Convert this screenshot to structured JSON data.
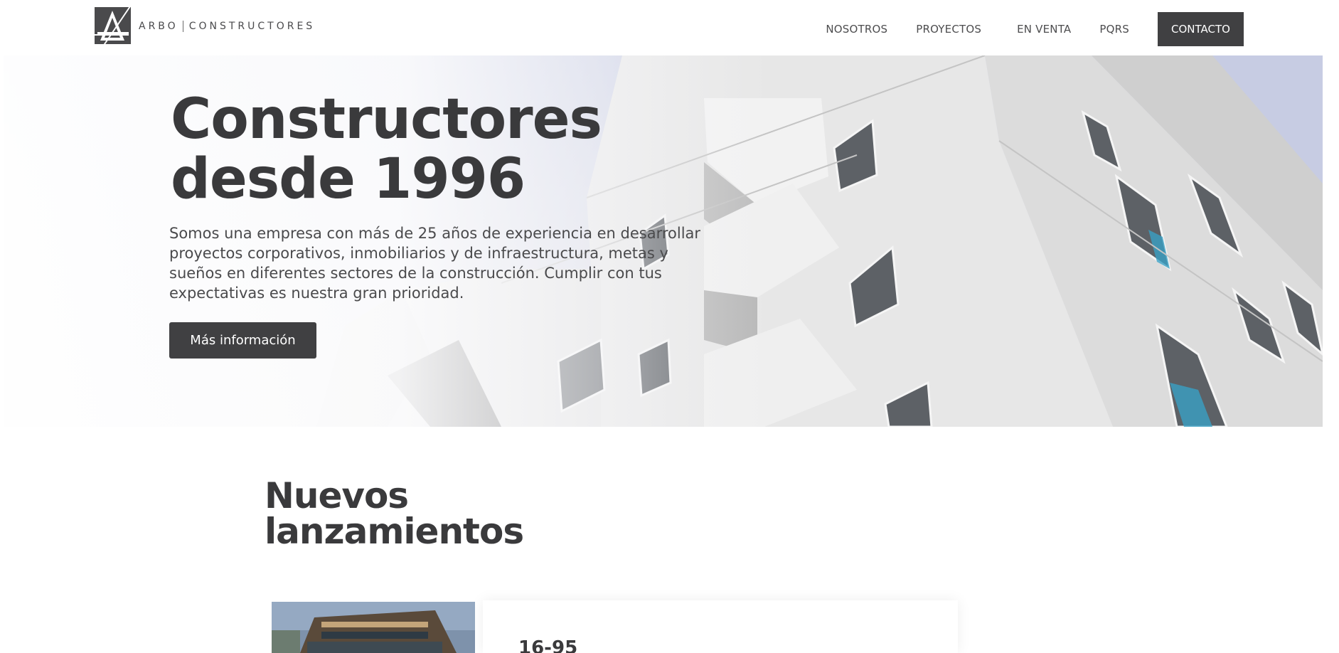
{
  "brand": {
    "name_left": "ARBO",
    "name_right": "CONSTRUCTORES",
    "logo_icon": "triangle-a-logo-icon"
  },
  "nav": {
    "items": [
      {
        "label": "NOSOTROS"
      },
      {
        "label": "PROYECTOS"
      },
      {
        "label": "EN VENTA"
      },
      {
        "label": "PQRS"
      }
    ],
    "cta_label": "CONTACTO"
  },
  "hero": {
    "title_line1": "Constructores",
    "title_line2": "desde 1996",
    "description": "Somos una empresa con más de 25 años de experiencia en desarrollar proyectos corporativos, inmobiliarios y de infraestructura, metas y sueños en diferentes sectores de la construcción. Cumplir con tus expectativas es nuestra gran prioridad.",
    "button_label": "Más información",
    "image": "white-apartment-building-photo"
  },
  "releases": {
    "title_line1": "Nuevos",
    "title_line2": "lanzamientos",
    "cards": [
      {
        "title": "16-95",
        "image": "building-rendering-photo"
      }
    ]
  },
  "colors": {
    "primary_dark": "#404042",
    "text": "#3a3a3c",
    "background": "#ffffff"
  }
}
